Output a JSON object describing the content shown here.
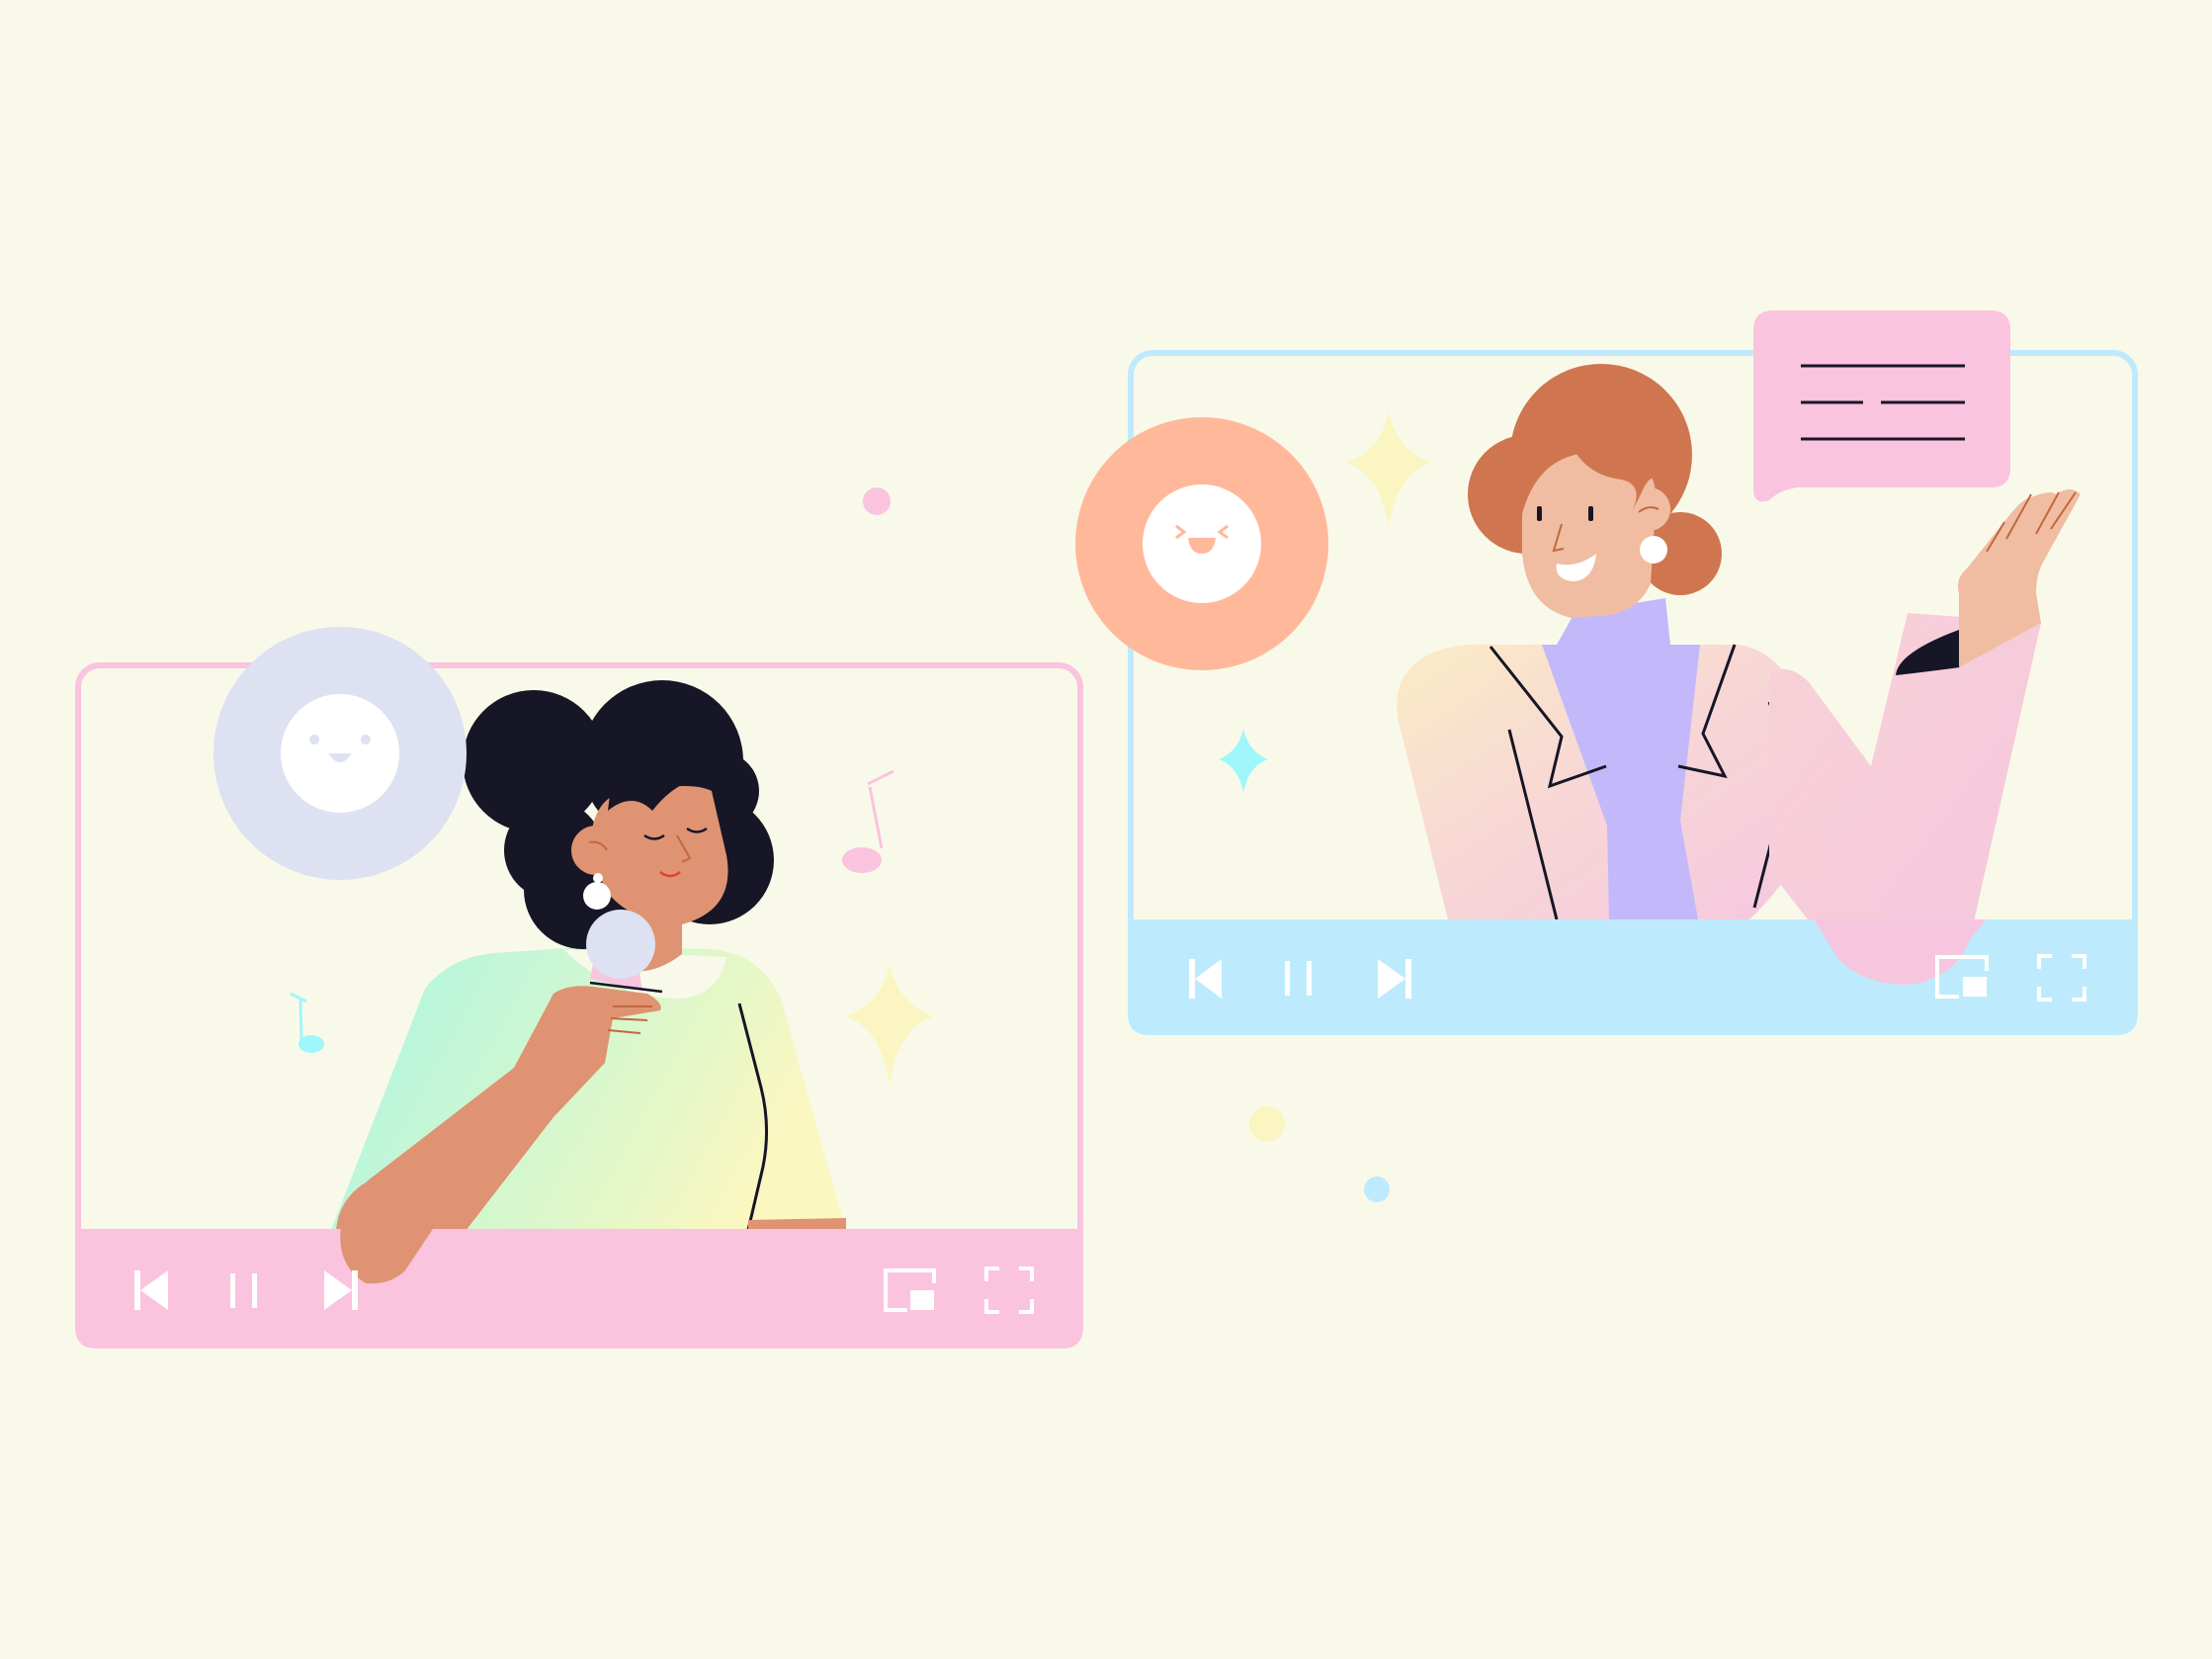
{
  "colors": {
    "background": "#f9f9ea",
    "player_left_frame": "#fac3de",
    "player_left_controls": "#fac3de",
    "player_right_frame": "#bfeafd",
    "player_right_controls": "#bdebfd",
    "speech_bubble": "#fac3de",
    "reaction_left": "#dde1f2",
    "reaction_right": "#ffb99a",
    "sparkle_yellow": "#fbf5c2",
    "sparkle_cyan": "#9ff7fb",
    "dark_hair": "#161626",
    "red_hair": "#cf7650",
    "skin_left": "#df9372",
    "skin_right": "#f0bda2",
    "turtleneck": "#c3b8fa"
  },
  "players": [
    {
      "id": "singer-player",
      "icons": [
        "skip-back-icon",
        "pause-icon",
        "skip-forward-icon",
        "picture-in-picture-icon",
        "fullscreen-icon"
      ]
    },
    {
      "id": "presenter-player",
      "icons": [
        "skip-back-icon",
        "pause-icon",
        "skip-forward-icon",
        "picture-in-picture-icon",
        "fullscreen-icon"
      ]
    }
  ],
  "decorations": [
    "smiley-icon",
    "happy-face-icon",
    "music-note-icon",
    "sparkle-icon",
    "speech-bubble-icon"
  ]
}
